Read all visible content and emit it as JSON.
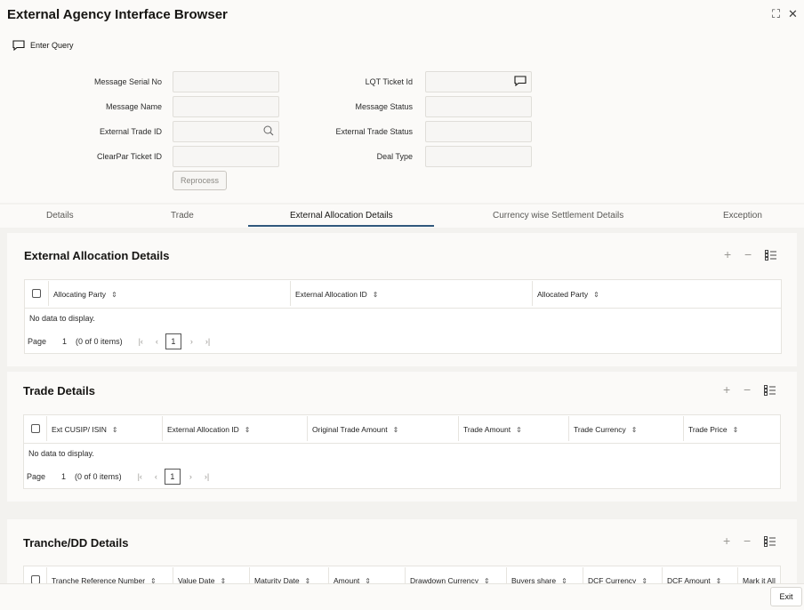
{
  "window": {
    "title": "External Agency Interface Browser"
  },
  "toolbar": {
    "enter_query": "Enter Query"
  },
  "form": {
    "message_serial_no": "Message Serial No",
    "message_name": "Message Name",
    "external_trade_id": "External Trade ID",
    "clearpar_ticket_id": "ClearPar Ticket ID",
    "lqt_ticket_id": "LQT Ticket Id",
    "message_status": "Message Status",
    "external_trade_status": "External Trade Status",
    "deal_type": "Deal Type",
    "reprocess": "Reprocess"
  },
  "tabs": [
    {
      "label": "Details"
    },
    {
      "label": "Trade"
    },
    {
      "label": "External Allocation Details"
    },
    {
      "label": "Currency wise Settlement Details"
    },
    {
      "label": "Exception"
    }
  ],
  "sections": {
    "allocation": {
      "title": "External Allocation Details",
      "columns": [
        "Allocating Party",
        "External Allocation ID",
        "Allocated Party"
      ],
      "no_data": "No data to display.",
      "page_label": "Page",
      "page_num": "1",
      "items": "(0 of 0 items)",
      "current_page": "1"
    },
    "trade": {
      "title": "Trade Details",
      "columns": [
        "Ext CUSIP/ ISIN",
        "External Allocation ID",
        "Original Trade Amount",
        "Trade Amount",
        "Trade Currency",
        "Trade Price"
      ],
      "no_data": "No data to display.",
      "page_label": "Page",
      "page_num": "1",
      "items": "(0 of 0 items)",
      "current_page": "1"
    },
    "tranche": {
      "title": "Tranche/DD Details",
      "columns": [
        "Tranche Reference Number",
        "Value Date",
        "Maturity Date",
        "Amount",
        "Drawdown Currency",
        "Buyers share",
        "DCF Currency",
        "DCF Amount",
        "Mark it All"
      ]
    }
  },
  "footer": {
    "exit": "Exit"
  }
}
